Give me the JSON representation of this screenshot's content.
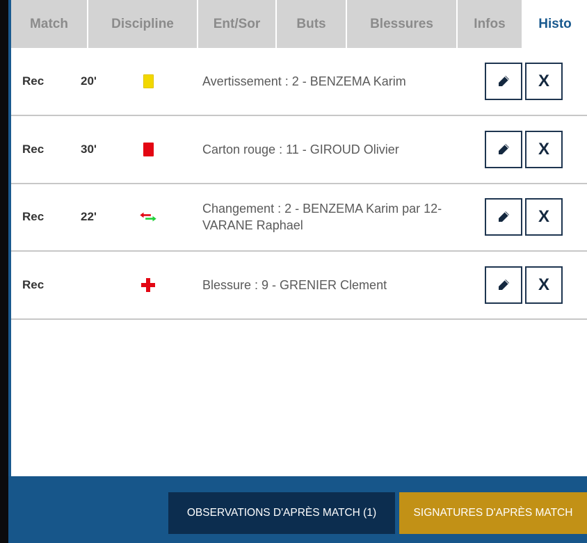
{
  "tabs": [
    {
      "label": "Match",
      "active": false
    },
    {
      "label": "Discipline",
      "active": false
    },
    {
      "label": "Ent/Sor",
      "active": false
    },
    {
      "label": "Buts",
      "active": false
    },
    {
      "label": "Blessures",
      "active": false
    },
    {
      "label": "Infos",
      "active": false
    },
    {
      "label": "Histo",
      "active": true
    }
  ],
  "events": [
    {
      "team": "Rec",
      "minute": "20'",
      "icon": "yellow-card-icon",
      "description": "Avertissement : 2 - BENZEMA Karim"
    },
    {
      "team": "Rec",
      "minute": "30'",
      "icon": "red-card-icon",
      "description": "Carton rouge : 11 - GIROUD Olivier"
    },
    {
      "team": "Rec",
      "minute": "22'",
      "icon": "substitution-arrows-icon",
      "description": "Changement : 2 - BENZEMA Karim par 12-VARANE Raphael"
    },
    {
      "team": "Rec",
      "minute": "",
      "icon": "injury-cross-icon",
      "description": "Blessure : 9 - GRENIER Clement"
    }
  ],
  "row_actions": {
    "delete_label": "X"
  },
  "footer": {
    "observations_label": "OBSERVATIONS D'APRÈS MATCH (1)",
    "signatures_label": "SIGNATURES D'APRÈS MATCH"
  },
  "colors": {
    "accent_blue": "#1a5a8f",
    "footer_blue": "#17568a",
    "dark_button": "#0c2d4f",
    "gold_button": "#c29116",
    "yellow_card": "#f2d800",
    "red_card": "#e30613"
  }
}
